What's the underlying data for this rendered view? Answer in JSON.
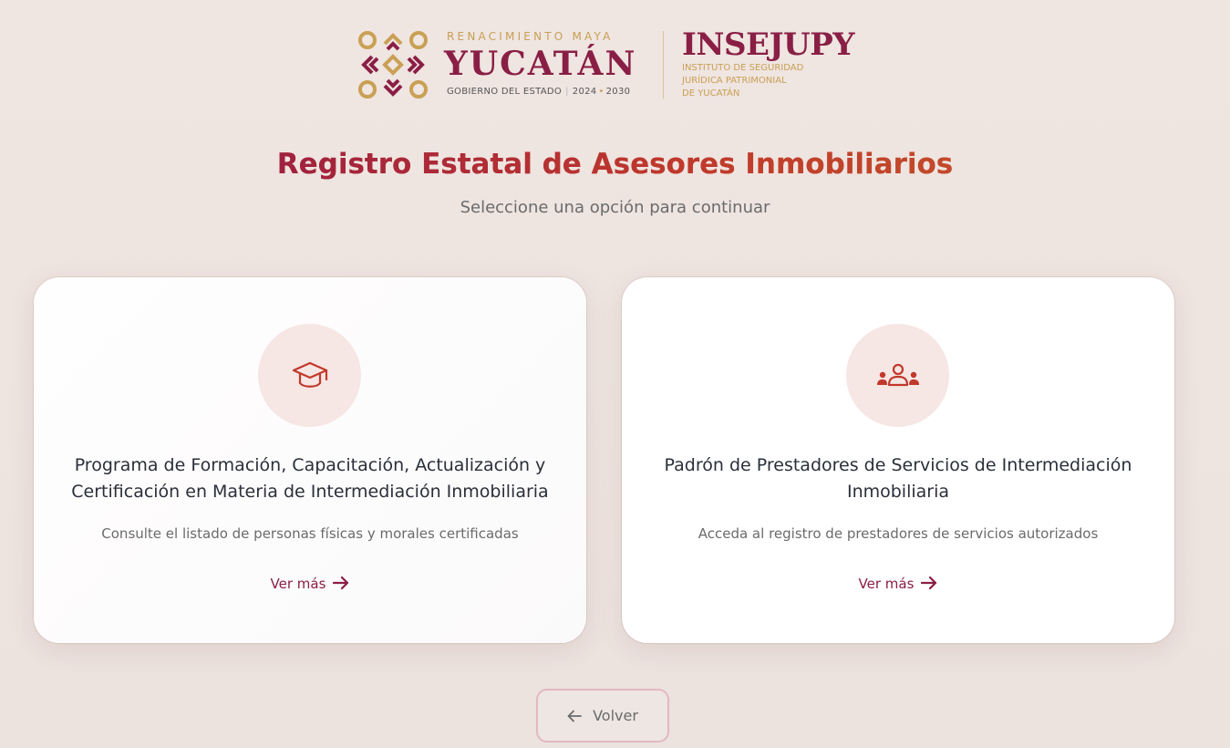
{
  "header": {
    "yucatan_logo": {
      "tagline": "RENACIMIENTO MAYA",
      "name": "YUCATÁN",
      "government": "GOBIERNO DEL ESTADO",
      "period_start": "2024",
      "period_end": "2030"
    },
    "insejupy_logo": {
      "name": "INSEJUPY",
      "line1": "INSTITUTO DE SEGURIDAD",
      "line2": "JURÍDICA PATRIMONIAL",
      "line3": "DE YUCATÁN"
    }
  },
  "page": {
    "title": "Registro Estatal de Asesores Inmobiliarios",
    "subtitle": "Seleccione una opción para continuar"
  },
  "cards": [
    {
      "icon": "graduation-cap-icon",
      "title": "Programa de Formación, Capacitación, Actualización y Certificación en Materia de Intermediación Inmobiliaria",
      "description": "Consulte el listado de personas físicas y morales certificadas",
      "link": "Ver más"
    },
    {
      "icon": "users-group-icon",
      "title": "Padrón de Prestadores de Servicios de Intermediación Inmobiliaria",
      "description": "Acceda al registro de prestadores de servicios autorizados",
      "link": "Ver más"
    }
  ],
  "back_button": {
    "label": "Volver",
    "icon": "arrow-left-icon"
  },
  "colors": {
    "brand_maroon": "#8a1f45",
    "brand_gold": "#c9a054",
    "title_red": "#a52a3a",
    "icon_accent": "#c0392b",
    "icon_bg": "#f6e6e4"
  }
}
